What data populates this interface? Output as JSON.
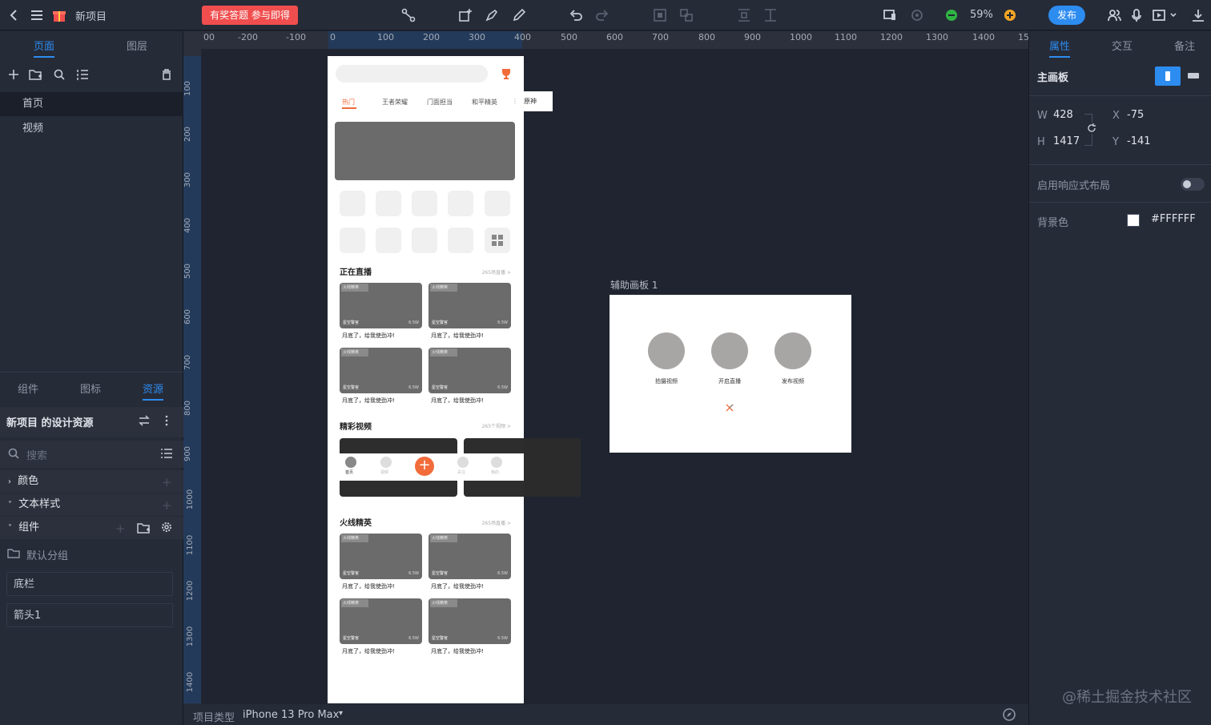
{
  "topbar": {
    "project_name": "新项目",
    "promo_label": "有奖答题 参与即得",
    "zoom": "59%",
    "publish_label": "发布"
  },
  "left_panel": {
    "tabs": [
      "页面",
      "图层"
    ],
    "pages": [
      "首页",
      "视频"
    ],
    "lower_tabs": [
      "组件",
      "图标",
      "资源"
    ],
    "resource_title": "新项目 的设计资源",
    "search_placeholder": "搜索",
    "sections": [
      "颜色",
      "文本样式",
      "组件"
    ],
    "group_name": "默认分组",
    "components": [
      "底栏",
      "箭头1"
    ]
  },
  "ruler": {
    "top_labels": [
      "00",
      "-200",
      "-100",
      "0",
      "100",
      "200",
      "300",
      "400",
      "500",
      "600",
      "700",
      "800",
      "900",
      "1000",
      "1100",
      "1200",
      "1300",
      "1400",
      "15"
    ],
    "left_labels": [
      "100",
      "200",
      "300",
      "400",
      "500",
      "600",
      "700",
      "800",
      "900",
      "1000",
      "1100",
      "1200",
      "1300",
      "1400"
    ]
  },
  "phone": {
    "tabs": [
      "热门",
      "王者荣耀",
      "门面担当",
      "和平精英",
      "原神"
    ],
    "sections": [
      {
        "title": "正在直播",
        "more": "265场直播 >"
      },
      {
        "title": "精彩视频",
        "more": "265个视频 >"
      },
      {
        "title": "火线精英",
        "more": "265场直播 >"
      }
    ],
    "card": {
      "badge": "火线精英",
      "name": "星空警官",
      "views": "6.5W",
      "caption": "月底了，给我使劲冲!"
    },
    "nav": [
      "首页",
      "视频",
      "关注",
      "我的"
    ]
  },
  "aux_board": {
    "label": "辅助画板  1",
    "buttons": [
      "拍摄视频",
      "开启直播",
      "发布视频"
    ]
  },
  "right_panel": {
    "tabs": [
      "属性",
      "交互",
      "备注"
    ],
    "board_title": "主画板",
    "w_label": "W",
    "w_value": "428",
    "h_label": "H",
    "h_value": "1417",
    "x_label": "X",
    "x_value": "-75",
    "y_label": "Y",
    "y_value": "-141",
    "responsive_label": "启用响应式布局",
    "bg_label": "背景色",
    "bg_value": "#FFFFFF"
  },
  "bottombar": {
    "type_label": "项目类型",
    "device": "iPhone 13 Pro Max"
  },
  "watermark": "@稀土掘金技术社区",
  "colors": {
    "accent": "#2d8cf0",
    "promo": "#f04e4e",
    "orange": "#f26b3a"
  }
}
